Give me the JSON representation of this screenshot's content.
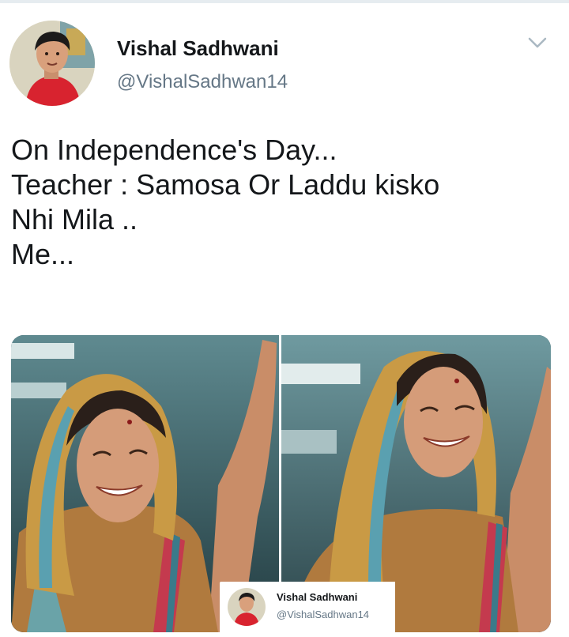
{
  "tweet": {
    "author_name": "Vishal Sadhwani",
    "author_handle": "@VishalSadhwan14",
    "text_lines": [
      "On Independence's Day...",
      "Teacher : Samosa Or Laddu kisko",
      "Nhi Mila ..",
      "Me..."
    ]
  },
  "watermark": {
    "name": "Vishal Sadhwani",
    "handle": "@VishalSadhwan14"
  },
  "icons": {
    "menu": "chevron-down-icon"
  },
  "colors": {
    "text": "#14171a",
    "secondary_text": "#657786",
    "divider": "#e6ecf0"
  }
}
